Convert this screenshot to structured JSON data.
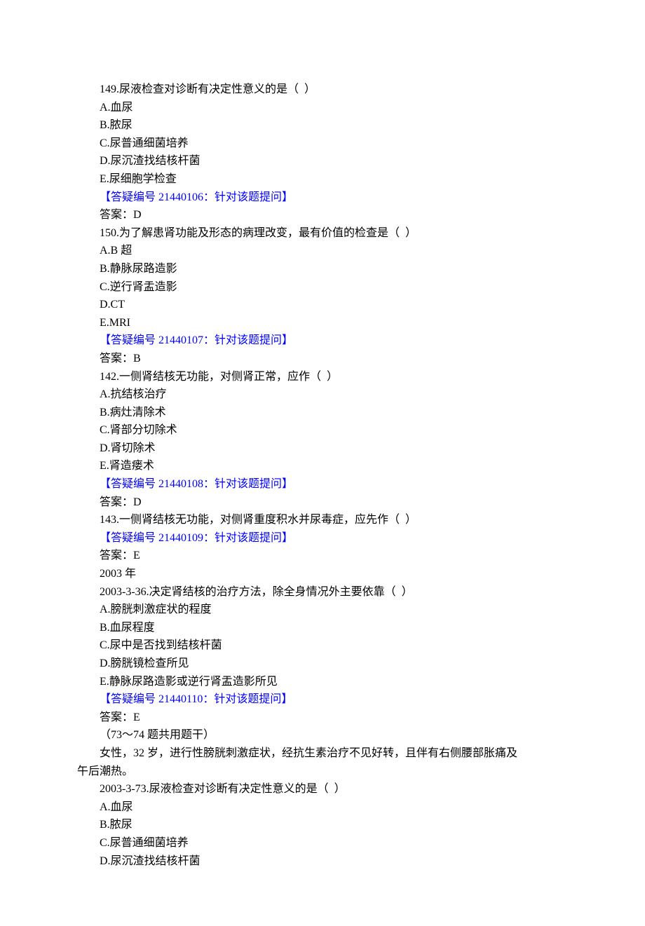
{
  "lines": [
    {
      "t": "149.尿液检查对诊断有决定性意义的是（  ）",
      "indent": true
    },
    {
      "t": "A.血尿",
      "indent": true
    },
    {
      "t": "B.脓尿",
      "indent": true
    },
    {
      "t": "C.尿普通细菌培养",
      "indent": true
    },
    {
      "t": "D.尿沉渣找结核杆菌",
      "indent": true
    },
    {
      "t": "E.尿细胞学检查",
      "indent": true
    },
    {
      "t": "【答疑编号 21440106：针对该题提问】",
      "indent": true,
      "link": true
    },
    {
      "t": "答案：D",
      "indent": true
    },
    {
      "t": "150.为了解患肾功能及形态的病理改变，最有价值的检查是（  ）",
      "indent": true
    },
    {
      "t": "A.B 超",
      "indent": true
    },
    {
      "t": "B.静脉尿路造影",
      "indent": true
    },
    {
      "t": "C.逆行肾盂造影",
      "indent": true
    },
    {
      "t": "D.CT",
      "indent": true
    },
    {
      "t": "E.MRI",
      "indent": true
    },
    {
      "t": "【答疑编号 21440107：针对该题提问】",
      "indent": true,
      "link": true
    },
    {
      "t": "答案：B",
      "indent": true
    },
    {
      "t": "142.一侧肾结核无功能，对侧肾正常，应作（  ）",
      "indent": true
    },
    {
      "t": "A.抗结核治疗",
      "indent": true
    },
    {
      "t": "B.病灶清除术",
      "indent": true
    },
    {
      "t": "C.肾部分切除术",
      "indent": true
    },
    {
      "t": "D.肾切除术",
      "indent": true
    },
    {
      "t": "E.肾造瘘术",
      "indent": true
    },
    {
      "t": "【答疑编号 21440108：针对该题提问】",
      "indent": true,
      "link": true
    },
    {
      "t": "答案：D",
      "indent": true
    },
    {
      "t": "143.一侧肾结核无功能，对侧肾重度积水并尿毒症，应先作（  ）",
      "indent": true
    },
    {
      "t": "【答疑编号 21440109：针对该题提问】",
      "indent": true,
      "link": true
    },
    {
      "t": "答案：E",
      "indent": true
    },
    {
      "t": "2003 年",
      "indent": true
    },
    {
      "t": "2003-3-36.决定肾结核的治疗方法，除全身情况外主要依靠（  ）",
      "indent": true
    },
    {
      "t": "A.膀胱刺激症状的程度",
      "indent": true
    },
    {
      "t": "B.血尿程度",
      "indent": true
    },
    {
      "t": "C.尿中是否找到结核杆菌",
      "indent": true
    },
    {
      "t": "D.膀胱镜检查所见",
      "indent": true
    },
    {
      "t": "E.静脉尿路造影或逆行肾盂造影所见",
      "indent": true
    },
    {
      "t": "【答疑编号 21440110：针对该题提问】",
      "indent": true,
      "link": true
    },
    {
      "t": "答案：E",
      "indent": true
    },
    {
      "t": "（73～74 题共用题干）",
      "indent": true
    },
    {
      "t": "女性，32 岁，进行性膀胱刺激症状，经抗生素治疗不见好转，且伴有右侧腰部胀痛及",
      "indent": true
    },
    {
      "t": "午后潮热。",
      "indent": false
    },
    {
      "t": "2003-3-73.尿液检查对诊断有决定性意义的是（  ）",
      "indent": true
    },
    {
      "t": "A.血尿",
      "indent": true
    },
    {
      "t": "B.脓尿",
      "indent": true
    },
    {
      "t": "C.尿普通细菌培养",
      "indent": true
    },
    {
      "t": "D.尿沉渣找结核杆菌",
      "indent": true
    }
  ]
}
